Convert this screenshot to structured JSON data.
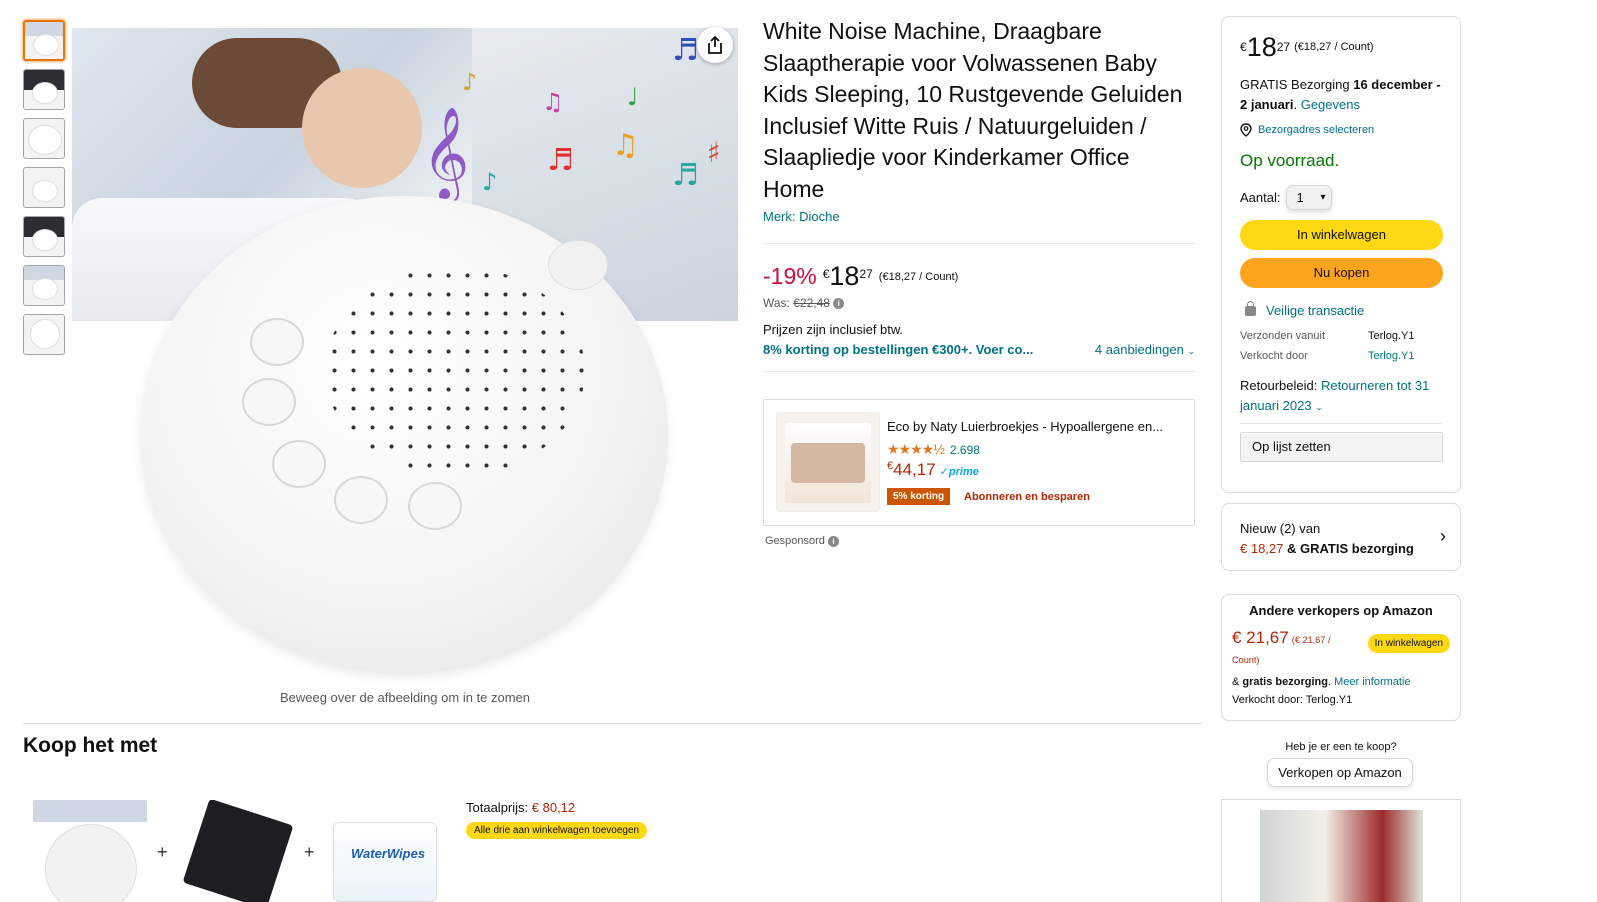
{
  "gallery": {
    "thumbnail_count": 7,
    "zoom_hint": "Beweeg over de afbeelding om in te zomen",
    "music_notes": [
      "𝄞",
      "♪",
      "♫",
      "♩",
      "♬",
      "♯",
      "♭"
    ]
  },
  "product": {
    "title": "White Noise Machine, Draagbare Slaaptherapie voor Volwassenen Baby Kids Sleeping, 10 Rustgevende Geluiden Inclusief Witte Ruis / Natuurgeluiden / Slaapliedje voor Kinderkamer Office Home",
    "brand": "Merk: Dioche",
    "discount": "-19%",
    "price_symbol": "€",
    "price_whole": "18",
    "price_fraction": "27",
    "price_unit": "(€18,27 / Count)",
    "was_label": "Was:",
    "was_price": "€22,48",
    "vat_note": "Prijzen zijn inclusief btw.",
    "promo": "8% korting op bestellingen €300+. Voer co...",
    "offers_link": "4 aanbiedingen"
  },
  "sponsored_ad": {
    "title": "Eco by Naty Luierbroekjes - Hypoallergene en...",
    "stars": "★★★★½",
    "rating_count": "2.698",
    "price_symbol": "€",
    "price": "44,17",
    "prime": "✓prime",
    "deal_badge": "5% korting",
    "deal_text": "Abonneren en besparen",
    "sponsored_label": "Gesponsord"
  },
  "buybox": {
    "price_symbol": "€",
    "price_whole": "18",
    "price_fraction": "27",
    "price_unit": "(€18,27 / Count)",
    "delivery_prefix": "GRATIS Bezorging",
    "delivery_dates": "16 december - 2 januari",
    "details_link": "Gegevens",
    "location_link": "Bezorgadres selecteren",
    "stock": "Op voorraad.",
    "qty_label": "Aantal:",
    "qty_value": "1",
    "add_to_cart": "In winkelwagen",
    "buy_now": "Nu kopen",
    "secure": "Veilige transactie",
    "shipped_from_label": "Verzonden vanuit",
    "shipped_from": "Terlog.Y1",
    "sold_by_label": "Verkocht door",
    "sold_by": "Terlog.Y1",
    "return_label": "Retourbeleid:",
    "return_link": "Retourneren tot 31 januari 2023",
    "add_to_list": "Op lijst zetten"
  },
  "new_offers": {
    "label": "Nieuw (2) van",
    "price": "€ 18,27",
    "shipping": "& GRATIS bezorging"
  },
  "other_sellers": {
    "heading": "Andere verkopers op Amazon",
    "price": "€ 21,67",
    "unit": "(€ 21,67 / Count)",
    "cart_button": "In winkelwagen",
    "shipping_prefix": "&",
    "shipping_bold": "gratis bezorging",
    "more_info": "Meer informatie",
    "sold_by": "Verkocht door: Terlog.Y1"
  },
  "sell": {
    "question": "Heb je er een te koop?",
    "button": "Verkopen op Amazon"
  },
  "bundle": {
    "heading": "Koop het met",
    "total_label": "Totaalprijs:",
    "total_price": "€ 80,12",
    "add_all": "Alle drie aan winkelwagen toevoegen",
    "plus": "+"
  },
  "colors": {
    "accent_cart": "#ffd814",
    "accent_buy": "#ffa41c",
    "link": "#007185",
    "deal_red": "#cc0c39",
    "in_stock": "#007600"
  }
}
